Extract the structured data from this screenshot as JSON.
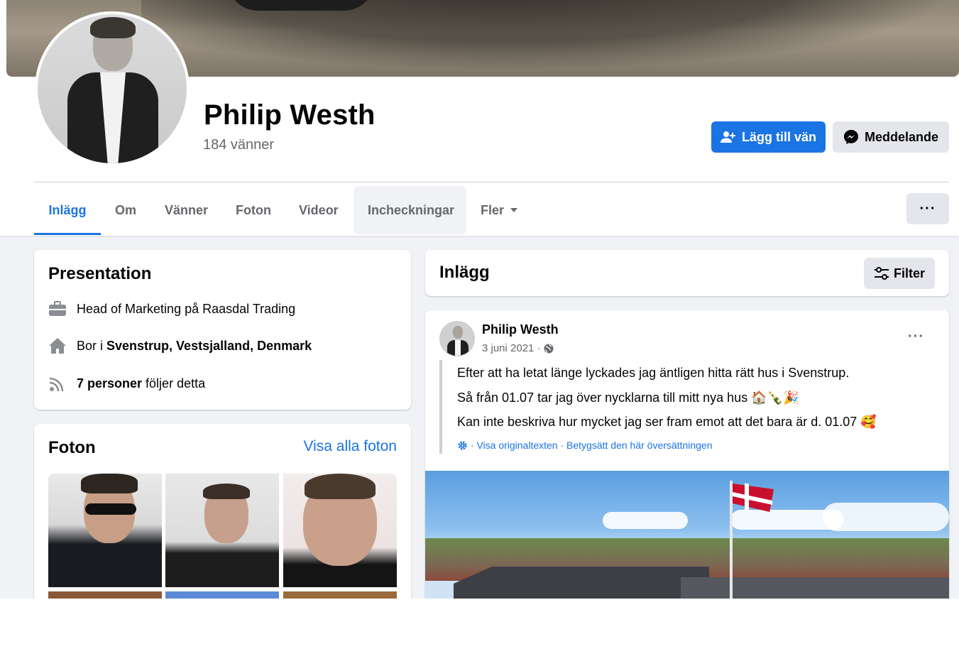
{
  "profile": {
    "name": "Philip Westh",
    "friends": "184 vänner"
  },
  "actions": {
    "add_friend": "Lägg till vän",
    "message": "Meddelande"
  },
  "tabs": [
    {
      "label": "Inlägg"
    },
    {
      "label": "Om"
    },
    {
      "label": "Vänner"
    },
    {
      "label": "Foton"
    },
    {
      "label": "Videor"
    },
    {
      "label": "Incheckningar"
    },
    {
      "label": "Fler"
    }
  ],
  "more_icon": "···",
  "intro": {
    "title": "Presentation",
    "work": "Head of Marketing på Raasdal Trading",
    "lives_prefix": "Bor i ",
    "lives_place": "Svenstrup, Vestsjalland, Denmark",
    "followers_bold": "7 personer",
    "followers_rest": " följer detta"
  },
  "photos": {
    "title": "Foton",
    "see_all": "Visa alla foton"
  },
  "posts_header": {
    "title": "Inlägg",
    "filter": "Filter"
  },
  "post": {
    "author": "Philip Westh",
    "date": "3 juni 2021",
    "separator": " · ",
    "line1": "Efter att ha letat länge lyckades jag äntligen hitta rätt hus i Svenstrup.",
    "line2": "Så från 01.07 tar jag över nycklarna till mitt nya hus 🏠🍾🎉",
    "line3": "Kan inte beskriva hur mycket jag ser fram emot att det bara är d. 01.07 🥰",
    "translate_text": " · Visa originaltexten · Betygsätt den här översättningen",
    "menu_icon": "···"
  },
  "colors": {
    "accent": "#1b74e4",
    "secondary_text": "#65676b",
    "background": "#f0f2f5",
    "button_gray": "#e4e6eb"
  }
}
